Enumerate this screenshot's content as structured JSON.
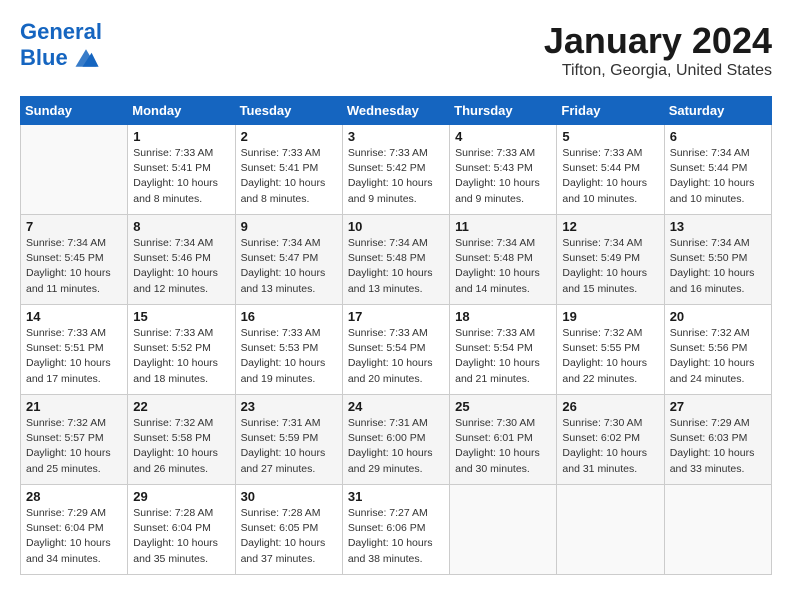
{
  "header": {
    "logo_line1": "General",
    "logo_line2": "Blue",
    "month_title": "January 2024",
    "location": "Tifton, Georgia, United States"
  },
  "weekdays": [
    "Sunday",
    "Monday",
    "Tuesday",
    "Wednesday",
    "Thursday",
    "Friday",
    "Saturday"
  ],
  "weeks": [
    [
      {
        "day": "",
        "info": ""
      },
      {
        "day": "1",
        "info": "Sunrise: 7:33 AM\nSunset: 5:41 PM\nDaylight: 10 hours\nand 8 minutes."
      },
      {
        "day": "2",
        "info": "Sunrise: 7:33 AM\nSunset: 5:41 PM\nDaylight: 10 hours\nand 8 minutes."
      },
      {
        "day": "3",
        "info": "Sunrise: 7:33 AM\nSunset: 5:42 PM\nDaylight: 10 hours\nand 9 minutes."
      },
      {
        "day": "4",
        "info": "Sunrise: 7:33 AM\nSunset: 5:43 PM\nDaylight: 10 hours\nand 9 minutes."
      },
      {
        "day": "5",
        "info": "Sunrise: 7:33 AM\nSunset: 5:44 PM\nDaylight: 10 hours\nand 10 minutes."
      },
      {
        "day": "6",
        "info": "Sunrise: 7:34 AM\nSunset: 5:44 PM\nDaylight: 10 hours\nand 10 minutes."
      }
    ],
    [
      {
        "day": "7",
        "info": "Sunrise: 7:34 AM\nSunset: 5:45 PM\nDaylight: 10 hours\nand 11 minutes."
      },
      {
        "day": "8",
        "info": "Sunrise: 7:34 AM\nSunset: 5:46 PM\nDaylight: 10 hours\nand 12 minutes."
      },
      {
        "day": "9",
        "info": "Sunrise: 7:34 AM\nSunset: 5:47 PM\nDaylight: 10 hours\nand 13 minutes."
      },
      {
        "day": "10",
        "info": "Sunrise: 7:34 AM\nSunset: 5:48 PM\nDaylight: 10 hours\nand 13 minutes."
      },
      {
        "day": "11",
        "info": "Sunrise: 7:34 AM\nSunset: 5:48 PM\nDaylight: 10 hours\nand 14 minutes."
      },
      {
        "day": "12",
        "info": "Sunrise: 7:34 AM\nSunset: 5:49 PM\nDaylight: 10 hours\nand 15 minutes."
      },
      {
        "day": "13",
        "info": "Sunrise: 7:34 AM\nSunset: 5:50 PM\nDaylight: 10 hours\nand 16 minutes."
      }
    ],
    [
      {
        "day": "14",
        "info": "Sunrise: 7:33 AM\nSunset: 5:51 PM\nDaylight: 10 hours\nand 17 minutes."
      },
      {
        "day": "15",
        "info": "Sunrise: 7:33 AM\nSunset: 5:52 PM\nDaylight: 10 hours\nand 18 minutes."
      },
      {
        "day": "16",
        "info": "Sunrise: 7:33 AM\nSunset: 5:53 PM\nDaylight: 10 hours\nand 19 minutes."
      },
      {
        "day": "17",
        "info": "Sunrise: 7:33 AM\nSunset: 5:54 PM\nDaylight: 10 hours\nand 20 minutes."
      },
      {
        "day": "18",
        "info": "Sunrise: 7:33 AM\nSunset: 5:54 PM\nDaylight: 10 hours\nand 21 minutes."
      },
      {
        "day": "19",
        "info": "Sunrise: 7:32 AM\nSunset: 5:55 PM\nDaylight: 10 hours\nand 22 minutes."
      },
      {
        "day": "20",
        "info": "Sunrise: 7:32 AM\nSunset: 5:56 PM\nDaylight: 10 hours\nand 24 minutes."
      }
    ],
    [
      {
        "day": "21",
        "info": "Sunrise: 7:32 AM\nSunset: 5:57 PM\nDaylight: 10 hours\nand 25 minutes."
      },
      {
        "day": "22",
        "info": "Sunrise: 7:32 AM\nSunset: 5:58 PM\nDaylight: 10 hours\nand 26 minutes."
      },
      {
        "day": "23",
        "info": "Sunrise: 7:31 AM\nSunset: 5:59 PM\nDaylight: 10 hours\nand 27 minutes."
      },
      {
        "day": "24",
        "info": "Sunrise: 7:31 AM\nSunset: 6:00 PM\nDaylight: 10 hours\nand 29 minutes."
      },
      {
        "day": "25",
        "info": "Sunrise: 7:30 AM\nSunset: 6:01 PM\nDaylight: 10 hours\nand 30 minutes."
      },
      {
        "day": "26",
        "info": "Sunrise: 7:30 AM\nSunset: 6:02 PM\nDaylight: 10 hours\nand 31 minutes."
      },
      {
        "day": "27",
        "info": "Sunrise: 7:29 AM\nSunset: 6:03 PM\nDaylight: 10 hours\nand 33 minutes."
      }
    ],
    [
      {
        "day": "28",
        "info": "Sunrise: 7:29 AM\nSunset: 6:04 PM\nDaylight: 10 hours\nand 34 minutes."
      },
      {
        "day": "29",
        "info": "Sunrise: 7:28 AM\nSunset: 6:04 PM\nDaylight: 10 hours\nand 35 minutes."
      },
      {
        "day": "30",
        "info": "Sunrise: 7:28 AM\nSunset: 6:05 PM\nDaylight: 10 hours\nand 37 minutes."
      },
      {
        "day": "31",
        "info": "Sunrise: 7:27 AM\nSunset: 6:06 PM\nDaylight: 10 hours\nand 38 minutes."
      },
      {
        "day": "",
        "info": ""
      },
      {
        "day": "",
        "info": ""
      },
      {
        "day": "",
        "info": ""
      }
    ]
  ]
}
